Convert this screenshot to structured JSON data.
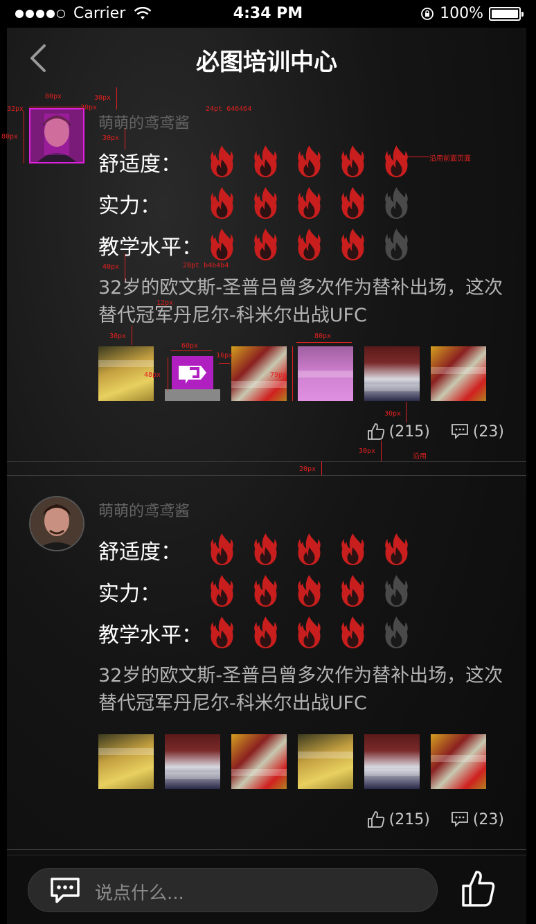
{
  "status": {
    "carrier": "Carrier",
    "time": "4:34 PM",
    "battery": "100%"
  },
  "nav": {
    "title": "必图培训中心"
  },
  "posts": [
    {
      "username": "萌萌的鸢鸢酱",
      "ratings": [
        {
          "label": "舒适度：",
          "score": 5,
          "max": 5
        },
        {
          "label": "实力：",
          "score": 4,
          "max": 5
        },
        {
          "label": "教学水平：",
          "score": 4,
          "max": 5
        }
      ],
      "description": "32岁的欧文斯-圣普吕曾多次作为替补出场，这次替代冠军丹尼尔-科米尔出战UFC",
      "likes": "(215)",
      "comments": "(23)"
    },
    {
      "username": "萌萌的鸢鸢酱",
      "ratings": [
        {
          "label": "舒适度：",
          "score": 5,
          "max": 5
        },
        {
          "label": "实力：",
          "score": 4,
          "max": 5
        },
        {
          "label": "教学水平：",
          "score": 4,
          "max": 5
        }
      ],
      "description": "32岁的欧文斯-圣普吕曾多次作为替补出场，这次替代冠军丹尼尔-科米尔出战UFC",
      "likes": "(215)",
      "comments": "(23)"
    }
  ],
  "input": {
    "placeholder": "说点什么..."
  },
  "annotations": {
    "a80": "80px",
    "a30": "30px",
    "a32": "32px",
    "a20": "20px",
    "a24": "24pt 646464",
    "a80v": "80px",
    "a30b": "30px",
    "aflame": "沿用前面页面",
    "a40": "40px",
    "a28": "28pt b4b4b4",
    "a12": "12px",
    "a30c": "30px",
    "a60": "60px",
    "a16": "16px",
    "a48": "48px",
    "a80b": "80px",
    "a79": "79px",
    "a30d": "30px",
    "a30e": "30px",
    "areuse": "沿用",
    "a20b": "20px"
  },
  "colors": {
    "flame_active": "#c81e1e",
    "flame_inactive": "#4a4a4a",
    "username": "#646464",
    "description": "#b4b4b4"
  }
}
